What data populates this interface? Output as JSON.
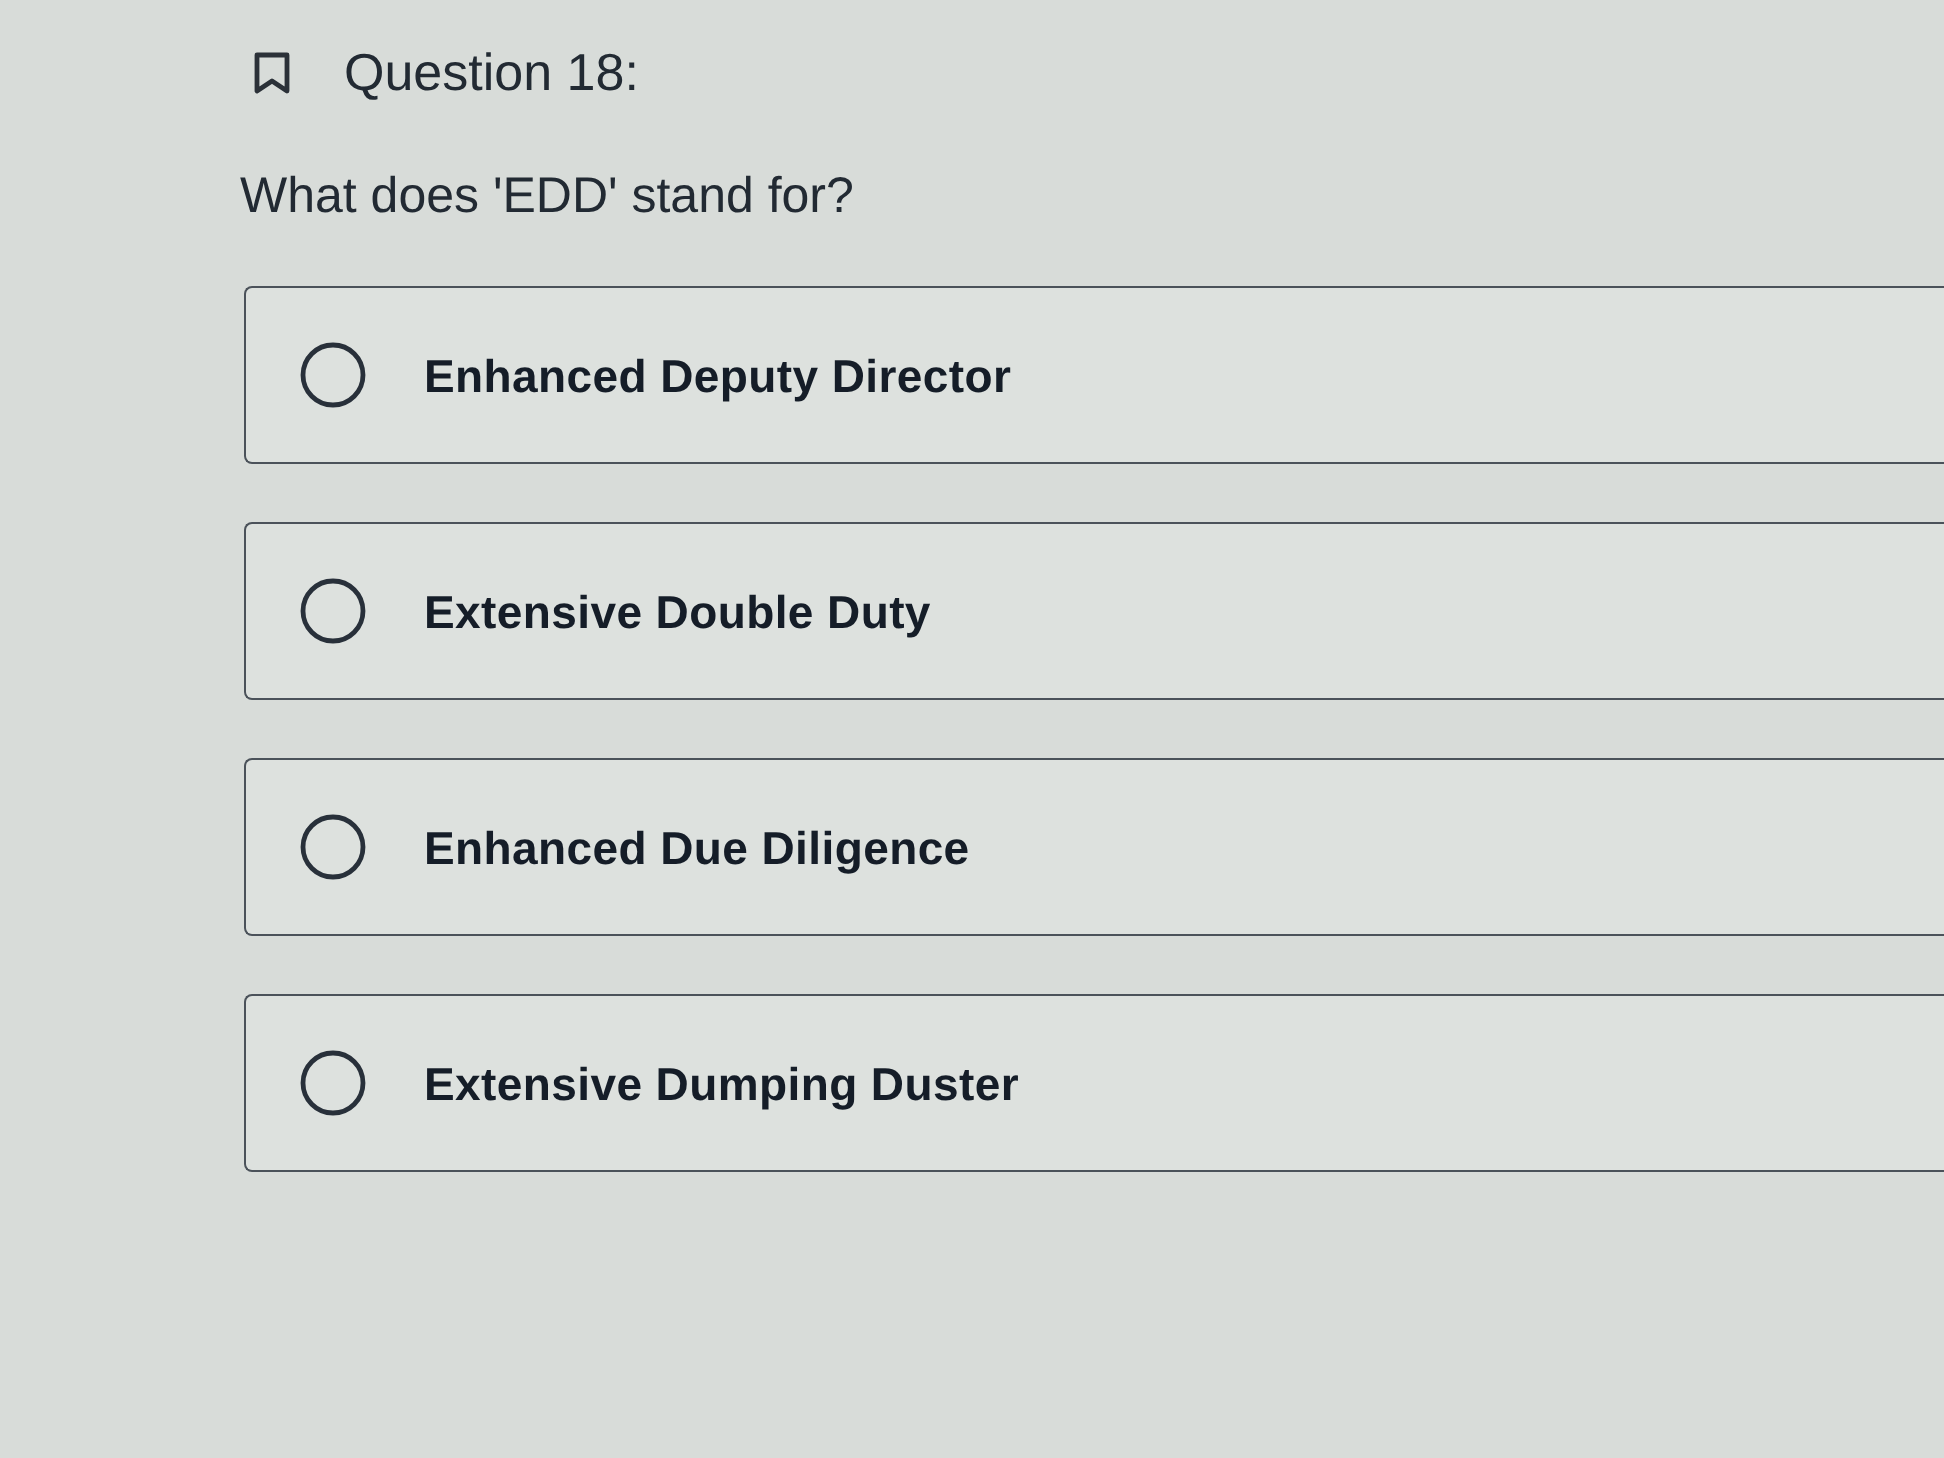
{
  "question": {
    "title": "Question 18:",
    "prompt": "What does 'EDD' stand for?"
  },
  "options": [
    {
      "label": "Enhanced Deputy Director",
      "selected": false
    },
    {
      "label": "Extensive Double Duty",
      "selected": false
    },
    {
      "label": "Enhanced Due Diligence",
      "selected": false
    },
    {
      "label": "Extensive Dumping Duster",
      "selected": false
    }
  ]
}
